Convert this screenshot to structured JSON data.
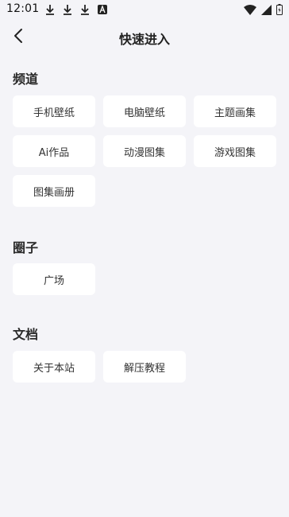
{
  "status_bar": {
    "time": "12:01",
    "left_icons": [
      "download-icon",
      "download-icon",
      "download-icon",
      "a-icon"
    ],
    "right_icons": [
      "wifi-icon",
      "signal-icon",
      "battery-icon"
    ]
  },
  "header": {
    "title": "快速进入",
    "back_icon": "back-chevron-icon"
  },
  "sections": [
    {
      "title": "频道",
      "items": [
        "手机壁纸",
        "电脑壁纸",
        "主题画集",
        "Ai作品",
        "动漫图集",
        "游戏图集",
        "图集画册"
      ]
    },
    {
      "title": "圈子",
      "items": [
        "广场"
      ]
    },
    {
      "title": "文档",
      "items": [
        "关于本站",
        "解压教程"
      ]
    }
  ],
  "colors": {
    "background": "#f4f4f8",
    "tile": "#ffffff",
    "text": "#333333"
  }
}
